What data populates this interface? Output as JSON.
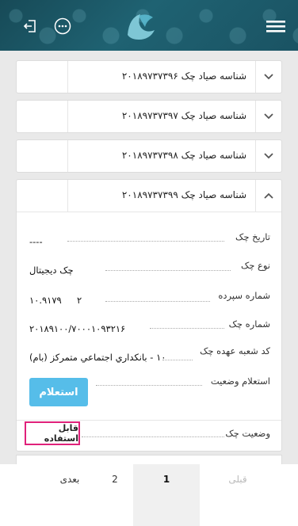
{
  "header": {
    "menu_icon": "hamburger-menu-icon",
    "logo_icon": "bank-logo-icon",
    "more_icon": "more-options-icon",
    "logout_icon": "logout-icon"
  },
  "cheques": [
    {
      "title": "شناسه صیاد چک ۲۰۱۸۹۷۳۷۳۹۶",
      "expanded": false
    },
    {
      "title": "شناسه صیاد چک ۲۰۱۸۹۷۳۷۳۹۷",
      "expanded": false
    },
    {
      "title": "شناسه صیاد چک ۲۰۱۸۹۷۳۷۳۹۸",
      "expanded": false
    },
    {
      "title": "شناسه صیاد چک ۲۰۱۸۹۷۳۷۳۹۹",
      "expanded": true
    }
  ],
  "detail": {
    "date_label": "تاریخ چک",
    "date_value": "----",
    "type_label": "نوع چک",
    "type_value": "چک دیجیتال",
    "deposit_label": "شماره سپرده",
    "deposit_value_a": "۲",
    "deposit_value_b": "۱۰.۹۱۷۹",
    "cheque_no_label": "شماره چک",
    "cheque_no_value": "۲۰۱۸۹۱۰۰/۷۰۰۰۱۰۹۳۲۱۶",
    "branch_label": "کد شعبه عهده چک",
    "branch_value": "۱۰ - بانكداري اجتماعي متمركز (بام)",
    "inquiry_label": "استعلام وضعیت",
    "inquiry_button": "استعلام",
    "status_label": "وضعیت چک",
    "status_value": "قابل استفاده"
  },
  "pagination": {
    "prev": "قبلی",
    "page1": "1",
    "page2": "2",
    "next": "بعدی"
  },
  "colors": {
    "header": "#1f6272",
    "button": "#56bde9",
    "status_highlight": "#e0217a"
  }
}
